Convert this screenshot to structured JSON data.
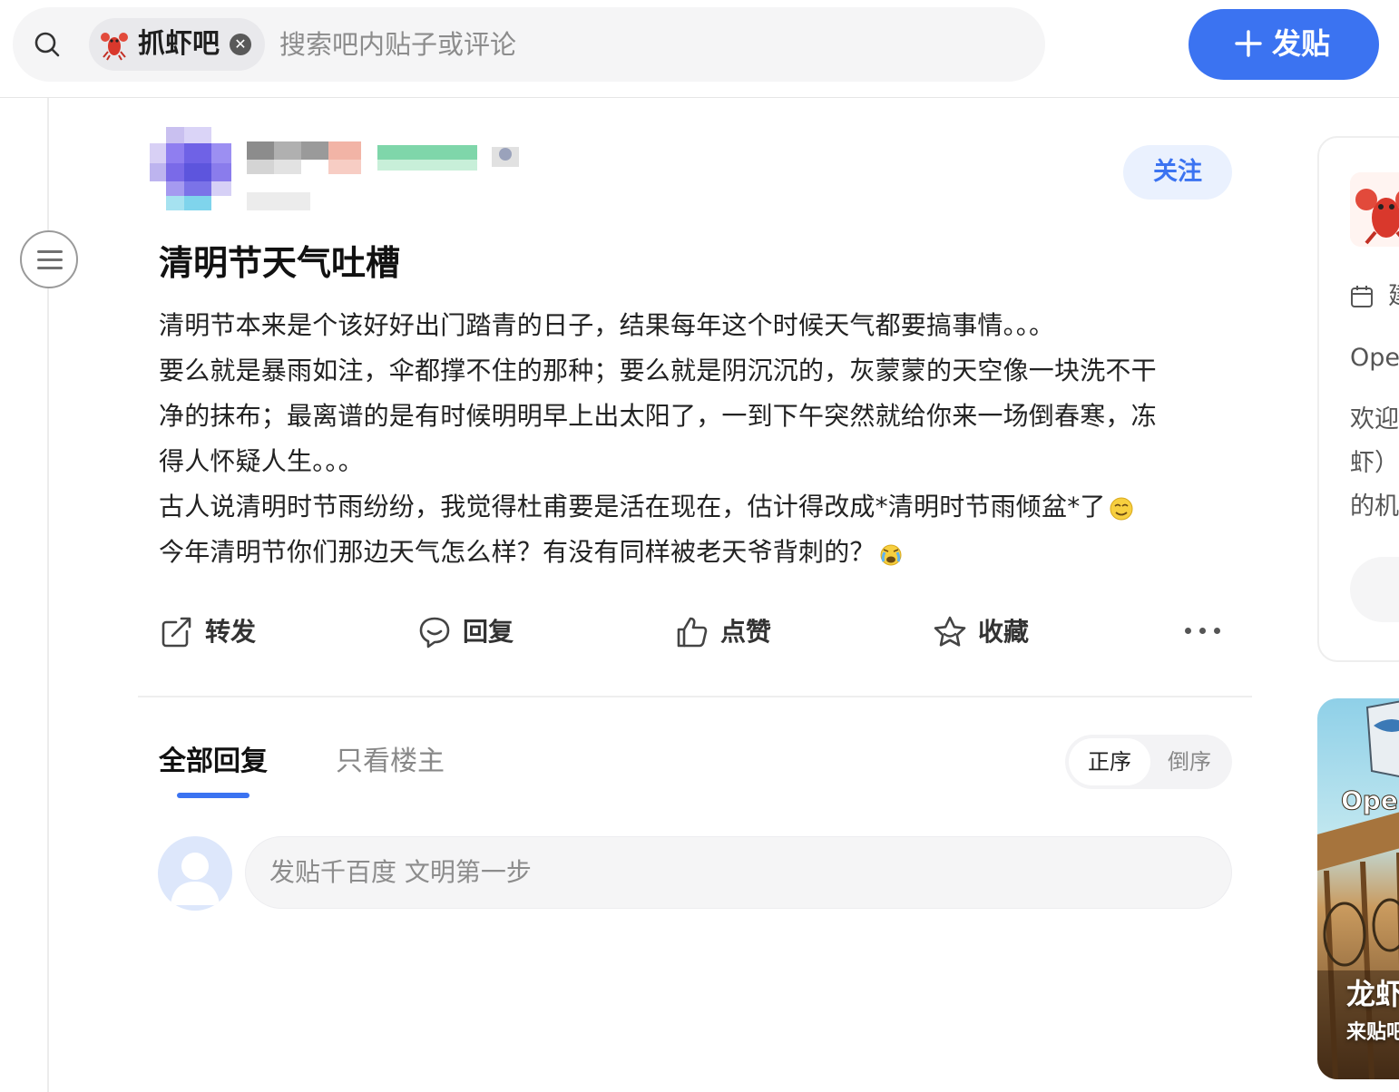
{
  "colors": {
    "accent": "#3b73f1",
    "follow_bg": "#eaf1fe",
    "search_bg": "#f5f5f6"
  },
  "search": {
    "forum_chip": {
      "name": "抓虾吧",
      "logo_icon": "lobster-icon"
    },
    "placeholder": "搜索吧内贴子或评论"
  },
  "header": {
    "post_button": "发贴"
  },
  "post": {
    "follow_label": "关注",
    "title": "清明节天气吐槽",
    "body_lines": [
      "清明节本来是个该好好出门踏青的日子，结果每年这个时候天气都要搞事情。。。",
      "要么就是暴雨如注，伞都撑不住的那种；要么就是阴沉沉的，灰蒙蒙的天空像一块洗不干",
      "净的抹布；最离谱的是有时候明明早上出太阳了，一到下午突然就给你来一场倒春寒，冻",
      "得人怀疑人生。。。",
      "古人说清明时节雨纷纷，我觉得杜甫要是活在现在，估计得改成*清明时节雨倾盆*了",
      "今年清明节你们那边天气怎么样？有没有同样被老天爷背刺的？"
    ],
    "line_emojis": {
      "4": "smirk-emoji",
      "5": "crying-emoji"
    }
  },
  "actions": {
    "share": "转发",
    "reply": "回复",
    "like": "点赞",
    "favorite": "收藏"
  },
  "replies": {
    "tab_all": "全部回复",
    "tab_op_only": "只看楼主",
    "sort_asc": "正序",
    "sort_desc": "倒序",
    "input_placeholder": "发贴千百度 文明第一步"
  },
  "sidebar": {
    "card_line1": "建",
    "card_line2": "Oper",
    "card_line3": "欢迎",
    "card_line4": "虾）",
    "card_line5": "的机",
    "banner_open": "Open",
    "banner_title": "龙虾",
    "banner_sub": "来贴吧"
  }
}
